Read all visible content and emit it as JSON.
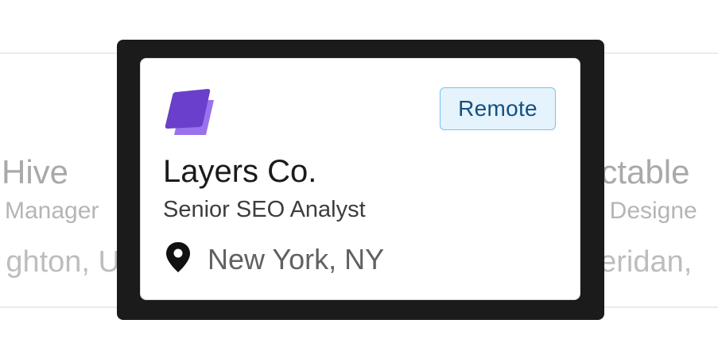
{
  "background_cards": {
    "left": {
      "company": "Hive",
      "role": "Manager",
      "location": "ghton, U"
    },
    "right": {
      "company": "ectable",
      "role": "ct Designe",
      "location": "neridan, "
    }
  },
  "card": {
    "logo_icon": "layers-logo-icon",
    "badge": "Remote",
    "company": "Layers Co.",
    "role": "Senior SEO Analyst",
    "location": "New York, NY",
    "location_icon": "map-pin-icon"
  },
  "colors": {
    "frame": "#1a1b1a",
    "badge_bg": "#e4f3fc",
    "badge_border": "#7cc1ec",
    "badge_text": "#15507f",
    "logo_primary": "#6a3fcb",
    "logo_secondary": "#9a72ec"
  }
}
